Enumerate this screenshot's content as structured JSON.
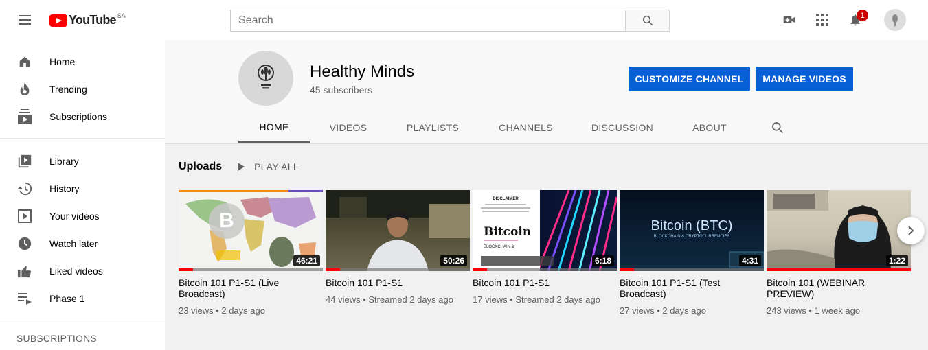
{
  "header": {
    "logo_text": "YouTube",
    "logo_region": "SA",
    "search_placeholder": "Search",
    "notification_count": "1"
  },
  "sidebar": {
    "items": [
      {
        "label": "Home",
        "icon": "home-icon"
      },
      {
        "label": "Trending",
        "icon": "fire-icon"
      },
      {
        "label": "Subscriptions",
        "icon": "subscriptions-icon"
      },
      {
        "label": "Library",
        "icon": "library-icon"
      },
      {
        "label": "History",
        "icon": "history-icon"
      },
      {
        "label": "Your videos",
        "icon": "your-videos-icon"
      },
      {
        "label": "Watch later",
        "icon": "clock-icon"
      },
      {
        "label": "Liked videos",
        "icon": "thumbs-up-icon"
      },
      {
        "label": "Phase 1",
        "icon": "playlist-icon"
      }
    ],
    "subscriptions_heading": "SUBSCRIPTIONS"
  },
  "channel": {
    "name": "Healthy Minds",
    "subscribers": "45 subscribers",
    "customize_label": "CUSTOMIZE CHANNEL",
    "manage_label": "MANAGE VIDEOS",
    "tabs": [
      "HOME",
      "VIDEOS",
      "PLAYLISTS",
      "CHANNELS",
      "DISCUSSION",
      "ABOUT"
    ],
    "active_tab": "HOME"
  },
  "uploads": {
    "title": "Uploads",
    "play_all": "PLAY ALL",
    "videos": [
      {
        "title": "Bitcoin 101 P1-S1 (Live Broadcast)",
        "meta": "23 views • 2 days ago",
        "duration": "46:21",
        "watched": 0.1
      },
      {
        "title": "Bitcoin 101 P1-S1",
        "meta": "44 views • Streamed 2 days ago",
        "duration": "50:26",
        "watched": 0.1
      },
      {
        "title": "Bitcoin 101 P1-S1",
        "meta": "17 views • Streamed 2 days ago",
        "duration": "6:18",
        "watched": 0.1
      },
      {
        "title": "Bitcoin 101 P1-S1 (Test Broadcast)",
        "meta": "27 views • 2 days ago",
        "duration": "4:31",
        "watched": 0.1
      },
      {
        "title": "Bitcoin 101 (WEBINAR PREVIEW)",
        "meta": "243 views • 1 week ago",
        "duration": "1:22",
        "watched": 1.0
      }
    ],
    "thumb_text": {
      "btc_title": "Bitcoin (BTC)",
      "btc_sub": "BLOCKCHAIN & CRYPTOCURRENCIES",
      "disclaimer": "DISCLAIMER",
      "bitcoin_word": "Bitcoin",
      "blockchain": "BLOCKCHAIN &"
    }
  },
  "colors": {
    "accent_blue": "#065fd4",
    "brand_red": "#ff0000",
    "badge_red": "#cc0000"
  }
}
